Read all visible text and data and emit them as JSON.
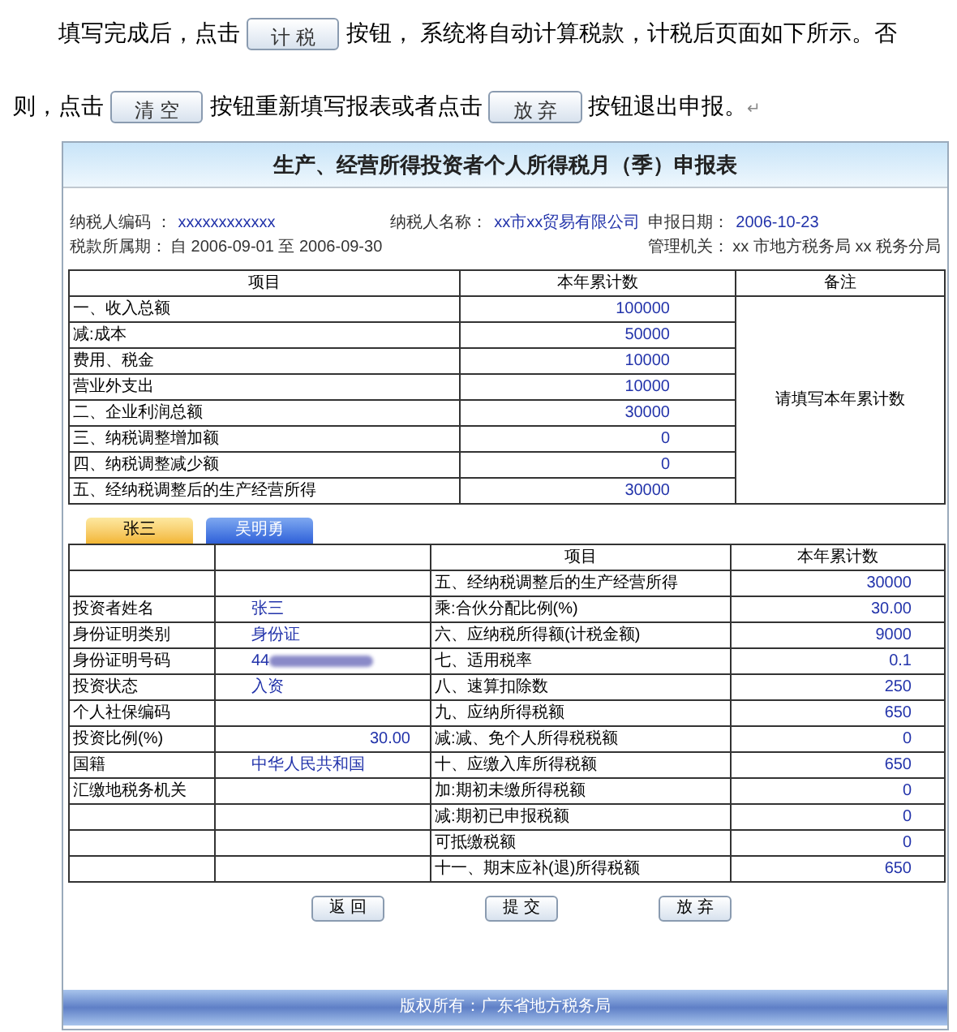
{
  "intro": {
    "lines": [
      [
        {
          "kind": "text",
          "text": "填写完成后，点击"
        },
        {
          "kind": "button",
          "text": "计 税"
        },
        {
          "kind": "text",
          "text": "按钮，  系统将自动计算税款，计税后页面如下所示。否"
        }
      ],
      [
        {
          "kind": "text",
          "text": "则，点击"
        },
        {
          "kind": "button",
          "text": "清 空"
        },
        {
          "kind": "text",
          "text": "按钮重新填写报表或者点击"
        },
        {
          "kind": "button",
          "text": "放 弃"
        },
        {
          "kind": "text",
          "text": "按钮退出申报。"
        },
        {
          "kind": "mark",
          "text": "↵"
        }
      ]
    ]
  },
  "form": {
    "title": "生产、经营所得投资者个人所得税月（季）申报表",
    "info": [
      {
        "label": "纳税人编码 ：",
        "value": "xxxxxxxxxxxx",
        "label2": "税款所属期：",
        "value2": "自 2006-09-01 至 2006-09-30"
      },
      {
        "label": "纳税人名称：",
        "value": "xx市xx贸易有限公司"
      },
      {
        "label": "申报日期：",
        "value": "2006-10-23",
        "label2": "管理机关：",
        "value2": "xx 市地方税务局 xx 税务分局"
      }
    ],
    "summary": {
      "columns": [
        "项目",
        "本年累计数",
        "备注"
      ],
      "note": "请填写本年累计数",
      "rows": [
        {
          "item": "一、收入总额",
          "value": "100000"
        },
        {
          "item": "减:成本",
          "value": "50000"
        },
        {
          "item": "费用、税金",
          "value": "10000"
        },
        {
          "item": "营业外支出",
          "value": "10000"
        },
        {
          "item": "二、企业利润总额",
          "value": "30000"
        },
        {
          "item": "三、纳税调整增加额",
          "value": "0"
        },
        {
          "item": "四、纳税调整减少额",
          "value": "0"
        },
        {
          "item": "五、经纳税调整后的生产经营所得",
          "value": "30000"
        }
      ]
    },
    "tabs": [
      {
        "label": "张三",
        "selected": true
      },
      {
        "label": "吴明勇",
        "selected": false
      }
    ],
    "investor": {
      "columns": [
        "项目",
        "本年累计数"
      ],
      "rows": [
        {
          "item": "五、经纳税调整后的生产经营所得",
          "value": "30000"
        },
        {
          "label": "投资者姓名",
          "field": {
            "kind": "text",
            "text": "张三"
          },
          "item": "乘:合伙分配比例(%)",
          "value": "30.00"
        },
        {
          "label": "身份证明类别",
          "field": {
            "kind": "text",
            "text": "身份证"
          },
          "item": "六、应纳税所得额(计税金额)",
          "value": "9000"
        },
        {
          "label": "身份证明号码",
          "field": {
            "kind": "redacted",
            "text": "44"
          },
          "item": "七、适用税率",
          "value": "0.1"
        },
        {
          "label": "投资状态",
          "field": {
            "kind": "text",
            "text": "入资"
          },
          "item": "八、速算扣除数",
          "value": "250"
        },
        {
          "label": "个人社保编码",
          "item": "九、应纳所得税额",
          "value": "650"
        },
        {
          "label": "投资比例(%)",
          "field": {
            "kind": "number",
            "text": "30.00"
          },
          "item": "减:减、免个人所得税税额",
          "value": "0"
        },
        {
          "label": "国籍",
          "field": {
            "kind": "text",
            "text": "中华人民共和国"
          },
          "item": "十、应缴入库所得税额",
          "value": "650"
        },
        {
          "label": "汇缴地税务机关",
          "item": "加:期初未缴所得税额",
          "value": "0"
        },
        {
          "item": "减:期初已申报税额",
          "value": "0"
        },
        {
          "item": "可抵缴税额",
          "value": "0"
        },
        {
          "item": "十一、期末应补(退)所得税额",
          "value": "650"
        }
      ]
    },
    "buttons": [
      "返 回",
      "提 交",
      "放 弃"
    ],
    "footer": "版权所有：广东省地方税务局"
  }
}
